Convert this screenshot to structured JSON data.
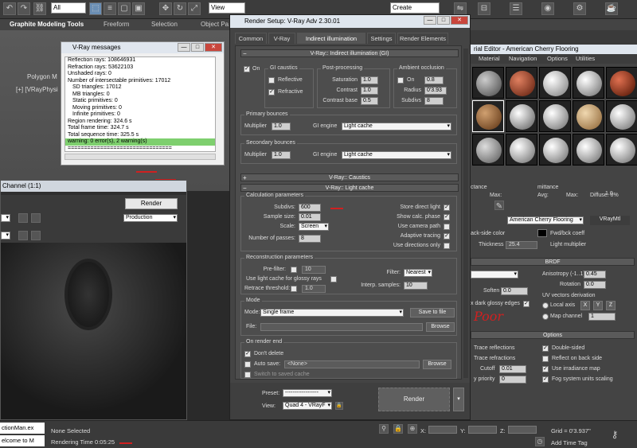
{
  "top_toolbar": {
    "filter_select": "All",
    "view_select": "View",
    "selection_set_select": "Create Selection Se"
  },
  "ribbon": {
    "tabs": [
      "Graphite Modeling Tools",
      "Freeform",
      "Selection",
      "Object Pa"
    ],
    "subtab": "Polygon M"
  },
  "viewport": {
    "label": "[+] [VRayPhysi"
  },
  "vray_messages": {
    "title": "V-Ray messages",
    "lines": [
      "Reflection rays: 108646931",
      "Refraction rays: 53622103",
      "Unshaded rays: 0",
      "Number of intersectable primitives: 17012",
      "SD triangles: 17012",
      "MB triangles: 0",
      "Static primitives: 0",
      "Moving primitives: 0",
      "Infinite primitives: 0",
      "Region rendering: 324.6 s",
      "Total frame time: 324.7 s",
      "Total sequence time: 325.5 s"
    ],
    "warning": "warning: 0 error(s), 2 warning(s)",
    "separator": "================================"
  },
  "frame_buffer": {
    "title": "Channel (1:1)",
    "render_button": "Render",
    "production_select": "Production"
  },
  "render_setup": {
    "title": "Render Setup: V-Ray Adv 2.30.01",
    "tabs": [
      "Common",
      "V-Ray",
      "Indirect illumination",
      "Settings",
      "Render Elements"
    ],
    "gi": {
      "header": "V-Ray:: Indirect illumination (GI)",
      "on_label": "On",
      "caustics_label": "GI caustics",
      "reflective": "Reflective",
      "refractive": "Refractive",
      "postproc_label": "Post-processing",
      "saturation_label": "Saturation",
      "saturation": "1.0",
      "contrast_label": "Contrast",
      "contrast": "1.0",
      "contrast_base_label": "Contrast base",
      "contrast_base": "0.5",
      "ao_label": "Ambient occlusion",
      "ao_on": "On",
      "ao_amount": "0.8",
      "radius_label": "Radius",
      "radius": "0'3.93",
      "subdivs_label": "Subdivs",
      "subdivs": "8",
      "primary_label": "Primary bounces",
      "primary_mult_label": "Multiplier",
      "primary_mult": "1.0",
      "primary_engine_label": "GI engine",
      "primary_engine": "Light cache",
      "secondary_label": "Secondary bounces",
      "secondary_mult_label": "Multiplier",
      "secondary_mult": "1.0",
      "secondary_engine_label": "GI engine",
      "secondary_engine": "Light cache"
    },
    "caustics_header": "V-Ray:: Caustics",
    "lc": {
      "header": "V-Ray:: Light cache",
      "calc_label": "Calculation parameters",
      "subdivs_label": "Subdivs:",
      "subdivs": "600",
      "sample_size_label": "Sample size:",
      "sample_size": "0.01",
      "scale_label": "Scale:",
      "scale": "Screen",
      "passes_label": "Number of passes:",
      "passes": "8",
      "store_direct": "Store direct light",
      "show_calc": "Show calc. phase",
      "use_camera": "Use camera path",
      "adaptive": "Adaptive tracing",
      "use_dirs": "Use directions only",
      "recon_label": "Reconstruction parameters",
      "prefilter_label": "Pre-filter:",
      "prefilter": "10",
      "glossy_label": "Use light cache for glossy rays",
      "retrace_label": "Retrace threshold:",
      "retrace": "1.0",
      "filter_label": "Filter:",
      "filter": "Nearest",
      "interp_label": "Interp. samples:",
      "interp": "10",
      "mode_group": "Mode",
      "mode_label": "Mode:",
      "mode": "Single frame",
      "save_button": "Save to file",
      "file_label": "File:",
      "browse": "Browse",
      "end_label": "On render end",
      "dont_delete": "Don't delete",
      "auto_save": "Auto save:",
      "auto_save_value": "<None>",
      "browse2": "Browse",
      "switch_saved": "Switch to saved cache"
    },
    "bottom": {
      "preset_label": "Preset:",
      "preset": "------------------",
      "view_label": "View:",
      "view": "Quad 4 - VRayF",
      "render_button": "Render"
    }
  },
  "material_editor": {
    "title": "rial Editor - American Cherry Flooring",
    "menu": [
      "Material",
      "Navigation",
      "Options",
      "Utilities"
    ],
    "material_name": "American Cherry Flooring",
    "material_type": "VRayMtl",
    "labels": {
      "diffuse": "Diffuse: 0%",
      "max": "Max:",
      "avg": "Avg:",
      "max2": "Max:",
      "ctance": "ctance",
      "mittance": "mittance",
      "back_side_color": "ack-side color",
      "fwd_coeff": "Fwd/bck coeff",
      "thickness": "Thickness",
      "thickness_value": "25.4",
      "light_multiplier": "Light multiplier",
      "light_multiplier_value": "1.0",
      "brdf": "BRDF",
      "anisotropy": "Anisotropy (-1..1)",
      "anisotropy_value": "0.45",
      "rotation": "Rotation",
      "rotation_value": "0.0",
      "soften": "Soften",
      "soften_value": "0.0",
      "dark_glossy": "x dark glossy edges",
      "uv_vectors": "UV vectors derivation",
      "local_axis": "Local axis",
      "axis_x": "X",
      "axis_y": "Y",
      "axis_z": "Z",
      "map_channel": "Map channel",
      "map_channel_value": "1",
      "options": "Options",
      "trace_reflections": "Trace reflections",
      "trace_refractions": "Trace refractions",
      "cutoff": "Cutoff",
      "cutoff_value": "0.01",
      "priority": "y priority",
      "priority_value": "0",
      "double_sided": "Double-sided",
      "reflect_back": "Reflect on back side",
      "irradiance": "Use irradiance map",
      "fog_scaling": "Fog system units scaling"
    }
  },
  "status_bar": {
    "script_line1": "ctionMan.ex",
    "script_line2": "elcome to M",
    "none_selected": "None Selected",
    "rendering_time": "Rendering Time  0:05:25",
    "x_label": "X:",
    "y_label": "Y:",
    "z_label": "Z:",
    "grid": "Grid = 0'3.937\"",
    "add_time_tag": "Add Time Tag"
  },
  "annotation": {
    "poor_text": "Poor"
  },
  "colors": {
    "warning_green": "#7ecf6e",
    "annotation_red": "#d02020",
    "title_bar": "#dfe6ee"
  }
}
